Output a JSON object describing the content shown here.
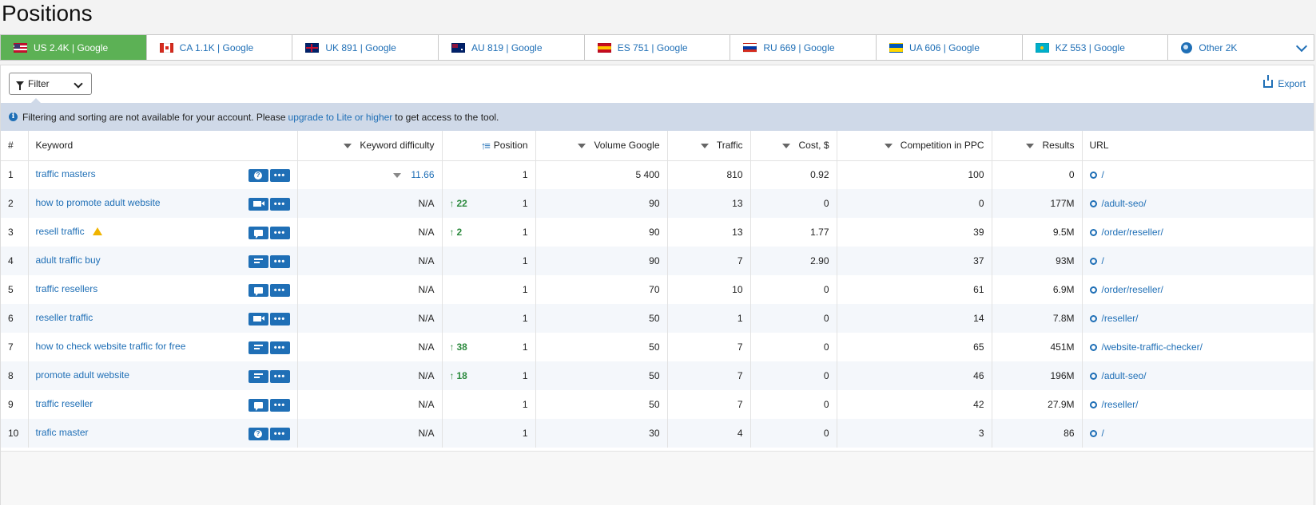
{
  "page_title": "Positions",
  "tabs": [
    {
      "label": "US 2.4K | Google",
      "flag": "us",
      "active": true
    },
    {
      "label": "CA 1.1K | Google",
      "flag": "ca",
      "active": false
    },
    {
      "label": "UK 891 | Google",
      "flag": "uk",
      "active": false
    },
    {
      "label": "AU 819 | Google",
      "flag": "au",
      "active": false
    },
    {
      "label": "ES 751 | Google",
      "flag": "es",
      "active": false
    },
    {
      "label": "RU 669 | Google",
      "flag": "ru",
      "active": false
    },
    {
      "label": "UA 606 | Google",
      "flag": "ua",
      "active": false
    },
    {
      "label": "KZ 553 | Google",
      "flag": "kz",
      "active": false
    },
    {
      "label": "Other 2K",
      "flag": "globe",
      "active": false
    }
  ],
  "toolbar": {
    "filter_label": "Filter",
    "export_label": "Export"
  },
  "notice": {
    "before": "Filtering and sorting are not available for your account. Please",
    "link": "upgrade to Lite or higher",
    "after": "to get access to the tool."
  },
  "columns": {
    "num": "#",
    "keyword": "Keyword",
    "kd": "Keyword difficulty",
    "position": "Position",
    "volume": "Volume Google",
    "traffic": "Traffic",
    "cost": "Cost, $",
    "competition": "Competition in PPC",
    "results": "Results",
    "url": "URL"
  },
  "rows": [
    {
      "n": "1",
      "keyword": "traffic masters",
      "warn": false,
      "icon": "question",
      "kd": "11.66",
      "kd_icon": true,
      "change": "",
      "position": "1",
      "volume": "5 400",
      "traffic": "810",
      "cost": "0.92",
      "competition": "100",
      "results": "0",
      "url": "/"
    },
    {
      "n": "2",
      "keyword": "how to promote adult website",
      "warn": false,
      "icon": "video",
      "kd": "N/A",
      "kd_icon": false,
      "change": "22",
      "position": "1",
      "volume": "90",
      "traffic": "13",
      "cost": "0",
      "competition": "0",
      "results": "177M",
      "url": "/adult-seo/"
    },
    {
      "n": "3",
      "keyword": "resell traffic",
      "warn": true,
      "icon": "chat",
      "kd": "N/A",
      "kd_icon": false,
      "change": "2",
      "position": "1",
      "volume": "90",
      "traffic": "13",
      "cost": "1.77",
      "competition": "39",
      "results": "9.5M",
      "url": "/order/reseller/"
    },
    {
      "n": "4",
      "keyword": "adult traffic buy",
      "warn": false,
      "icon": "text",
      "kd": "N/A",
      "kd_icon": false,
      "change": "",
      "position": "1",
      "volume": "90",
      "traffic": "7",
      "cost": "2.90",
      "competition": "37",
      "results": "93M",
      "url": "/"
    },
    {
      "n": "5",
      "keyword": "traffic resellers",
      "warn": false,
      "icon": "chat",
      "kd": "N/A",
      "kd_icon": false,
      "change": "",
      "position": "1",
      "volume": "70",
      "traffic": "10",
      "cost": "0",
      "competition": "61",
      "results": "6.9M",
      "url": "/order/reseller/"
    },
    {
      "n": "6",
      "keyword": "reseller traffic",
      "warn": false,
      "icon": "video",
      "kd": "N/A",
      "kd_icon": false,
      "change": "",
      "position": "1",
      "volume": "50",
      "traffic": "1",
      "cost": "0",
      "competition": "14",
      "results": "7.8M",
      "url": "/reseller/"
    },
    {
      "n": "7",
      "keyword": "how to check website traffic for free",
      "warn": false,
      "icon": "text",
      "kd": "N/A",
      "kd_icon": false,
      "change": "38",
      "position": "1",
      "volume": "50",
      "traffic": "7",
      "cost": "0",
      "competition": "65",
      "results": "451M",
      "url": "/website-traffic-checker/"
    },
    {
      "n": "8",
      "keyword": "promote adult website",
      "warn": false,
      "icon": "text",
      "kd": "N/A",
      "kd_icon": false,
      "change": "18",
      "position": "1",
      "volume": "50",
      "traffic": "7",
      "cost": "0",
      "competition": "46",
      "results": "196M",
      "url": "/adult-seo/"
    },
    {
      "n": "9",
      "keyword": "traffic reseller",
      "warn": false,
      "icon": "chat",
      "kd": "N/A",
      "kd_icon": false,
      "change": "",
      "position": "1",
      "volume": "50",
      "traffic": "7",
      "cost": "0",
      "competition": "42",
      "results": "27.9M",
      "url": "/reseller/"
    },
    {
      "n": "10",
      "keyword": "trafic master",
      "warn": false,
      "icon": "question",
      "kd": "N/A",
      "kd_icon": false,
      "change": "",
      "position": "1",
      "volume": "30",
      "traffic": "4",
      "cost": "0",
      "competition": "3",
      "results": "86",
      "url": "/"
    }
  ],
  "colors": {
    "accent": "#1f6fb6",
    "active_tab": "#5cb155",
    "notice_bg": "#cfd9e8",
    "positive": "#2c8a3e"
  }
}
